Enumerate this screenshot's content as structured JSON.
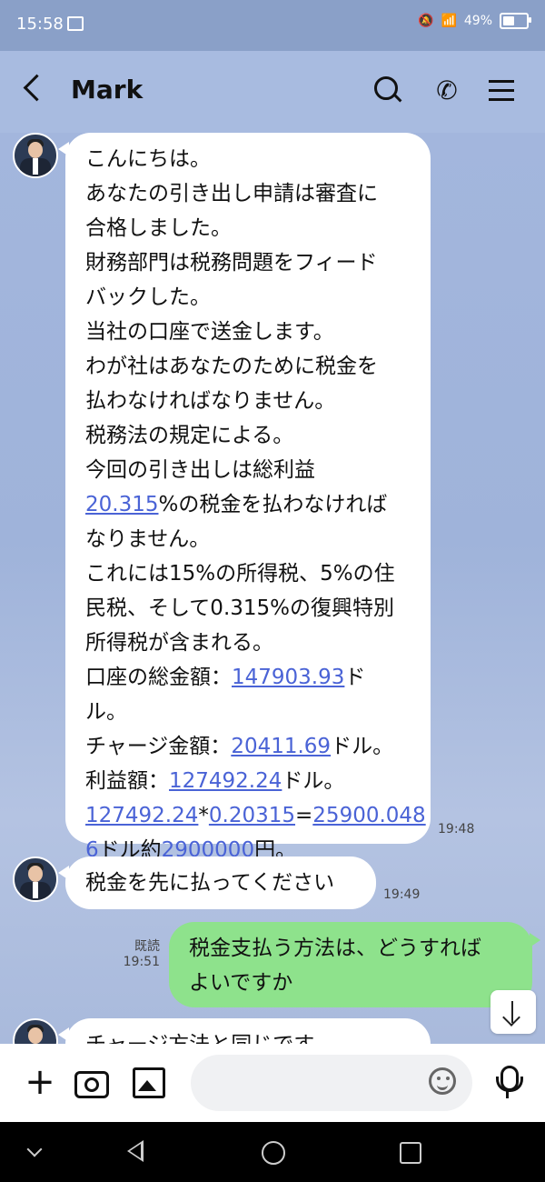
{
  "status_bar": {
    "time": "15:58",
    "battery": "49%",
    "battery_level": 0.49
  },
  "header": {
    "contact_name": "Mark"
  },
  "messages": [
    {
      "side": "left",
      "lines": [
        [
          "こんにちは。"
        ],
        [
          "あなたの引き出し申請は審査に"
        ],
        [
          "合格しました。"
        ],
        [
          "財務部門は税務問題をフィード"
        ],
        [
          "バックした。"
        ],
        [
          "当社の口座で送金します。"
        ],
        [
          "わが社はあなたのために税金を"
        ],
        [
          "払わなければなりません。"
        ],
        [
          "税務法の規定による。"
        ],
        [
          "今回の引き出しは総利益"
        ],
        [
          {
            "link": "20.315"
          },
          "%の税金を払わなければ"
        ],
        [
          "なりません。"
        ],
        [
          "これには15%の所得税、5%の住"
        ],
        [
          "民税、そして0.315%の復興特別"
        ],
        [
          "所得税が含まれる。"
        ],
        [
          "口座の総金額：",
          {
            "link": "147903.93"
          },
          "ド"
        ],
        [
          "ル。"
        ],
        [
          "チャージ金額：",
          {
            "link": "20411.69"
          },
          "ドル。"
        ],
        [
          "利益額：",
          {
            "link": "127492.24"
          },
          "ドル。"
        ],
        [
          {
            "link": "127492.24"
          },
          "*",
          {
            "link": "0.20315"
          },
          "=",
          {
            "link": "25900.048"
          }
        ],
        [
          {
            "link": "6"
          },
          "ドル約",
          {
            "link": "2900000"
          },
          "円。"
        ]
      ],
      "time": "19:48"
    },
    {
      "side": "left",
      "lines": [
        [
          "税金を先に払ってください"
        ]
      ],
      "time": "19:49"
    },
    {
      "side": "right",
      "lines": [
        [
          "税金支払う方法は、どうすれば"
        ],
        [
          "よいですか"
        ]
      ],
      "read": "既読",
      "time": "19:51"
    },
    {
      "side": "left",
      "lines": [
        [
          "チャージ方法と同じです"
        ]
      ],
      "time": ""
    }
  ],
  "input": {
    "placeholder": ""
  }
}
